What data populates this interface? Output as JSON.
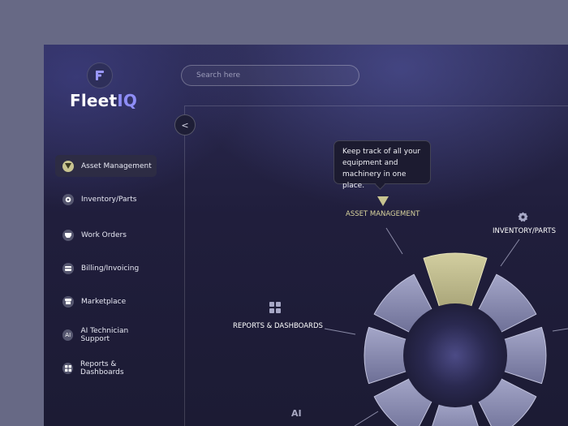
{
  "brand": {
    "name_part1": "Fleet",
    "name_part2": "IQ"
  },
  "search": {
    "placeholder": "Search here"
  },
  "sidebar": {
    "collapse_glyph": "<",
    "items": [
      {
        "label": "Asset Management",
        "icon": "triangle-icon",
        "active": true
      },
      {
        "label": "Inventory/Parts",
        "icon": "gear-icon"
      },
      {
        "label": "Work Orders",
        "icon": "tray-icon"
      },
      {
        "label": "Billing/Invoicing",
        "icon": "card-icon"
      },
      {
        "label": "Marketplace",
        "icon": "store-icon"
      },
      {
        "label": "AI Technician Support",
        "icon": "ai-icon",
        "icon_text": "AI"
      },
      {
        "label": "Reports & Dashboards",
        "icon": "grid-icon"
      }
    ]
  },
  "wheel": {
    "tooltip": "Keep track of all your equipment and machinery in one place.",
    "labels": {
      "asset": "ASSET MANAGEMENT",
      "inventory": "INVENTORY/PARTS",
      "reports": "REPORTS & DASHBOARDS",
      "ai": "AI"
    },
    "active_color": "#c8c490",
    "segment_color": "#8f90b4"
  }
}
